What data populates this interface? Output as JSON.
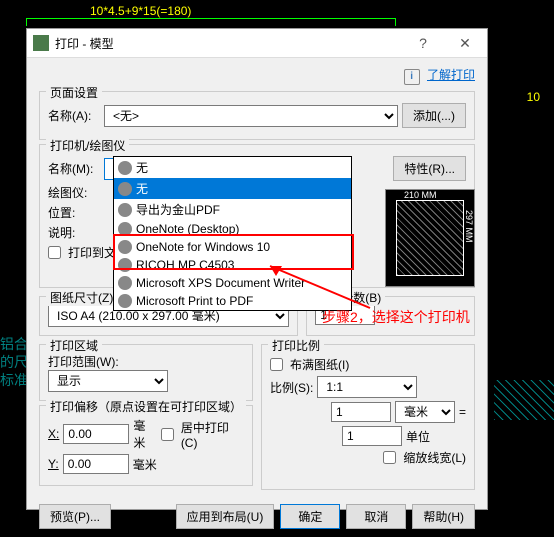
{
  "cad": {
    "dim": "10*4.5+9*15(=180)",
    "bg1": "铝合金",
    "bg2": "的尺",
    "bg3": "标准"
  },
  "dlg": {
    "title": "打印 - 模型",
    "help_link": "了解打印",
    "page_setup": "页面设置",
    "name_a": "名称(A):",
    "name_a_val": "<无>",
    "add_btn": "添加(...)",
    "printer_group": "打印机/绘图仪",
    "name_m": "名称(M):",
    "name_m_val": "无",
    "props_btn": "特性(R)...",
    "plotter": "绘图仪:",
    "location": "位置:",
    "desc": "说明:",
    "print_to_file": "打印到文",
    "dd": {
      "i0": "无",
      "i1": "无",
      "i2": "导出为金山PDF",
      "i3": "OneNote (Desktop)",
      "i4": "OneNote for Windows 10",
      "i5": "RICOH MP C4503",
      "i6": "Microsoft XPS Document Writer",
      "i7": "Microsoft Print to PDF"
    },
    "paper_w": "210 MM",
    "paper_h": "297 MM",
    "paper_size": "图纸尺寸(Z)",
    "paper_size_val": "ISO A4 (210.00 x 297.00 毫米)",
    "copies": "打印份数(B)",
    "copies_val": "1",
    "area": "打印区域",
    "area_range": "打印范围(W):",
    "area_val": "显示",
    "scale": "打印比例",
    "fit": "布满图纸(I)",
    "ratio": "比例(S):",
    "ratio_val": "1:1",
    "offset": "打印偏移（原点设置在可打印区域）",
    "x": "X:",
    "x_val": "0.00",
    "y": "Y:",
    "y_val": "0.00",
    "mm": "毫米",
    "unit": "单位",
    "center": "居中打印(C)",
    "scale_lw": "缩放线宽(L)",
    "one": "1",
    "preview_btn": "预览(P)...",
    "apply_btn": "应用到布局(U)",
    "ok": "确定",
    "cancel": "取消",
    "help": "帮助(H)"
  },
  "annot": {
    "step2": "步骤2，选择这个打印机"
  }
}
